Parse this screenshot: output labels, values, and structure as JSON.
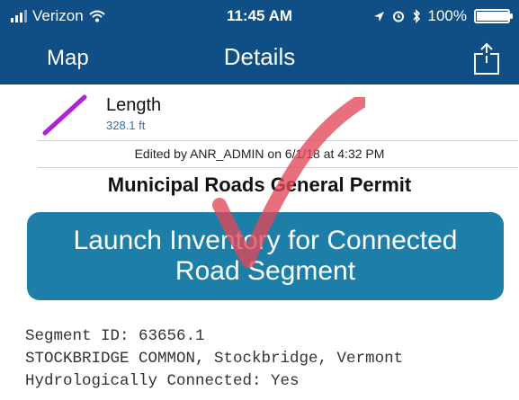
{
  "status_bar": {
    "carrier": "Verizon",
    "time": "11:45 AM",
    "battery": "100%",
    "battery_level": 1.0
  },
  "nav": {
    "back_label": "Map",
    "title": "Details",
    "share_icon": "share-icon"
  },
  "feature": {
    "label": "Length",
    "value": "328.1 ft",
    "line_color": "#b020d8"
  },
  "edited_text": "Edited by ANR_ADMIN on 6/1/18 at 4:32 PM",
  "section_title": "Municipal Roads General Permit",
  "launch_button": {
    "label": "Launch Inventory for Connected Road Segment",
    "color": "#1d7ea8"
  },
  "info_lines": [
    "Segment ID: 63656.1",
    "STOCKBRIDGE COMMON, Stockbridge, Vermont",
    "Hydrologically Connected: Yes"
  ],
  "colors": {
    "header": "#0f4f86",
    "checkmark": "#e0475a"
  }
}
